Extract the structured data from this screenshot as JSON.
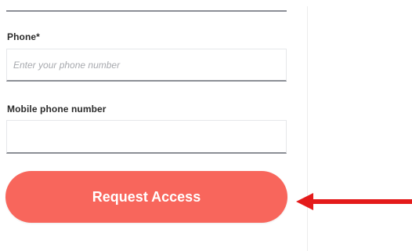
{
  "form": {
    "phone_label": "Phone*",
    "phone_placeholder": "Enter your phone number",
    "mobile_label": "Mobile phone number",
    "mobile_placeholder": ""
  },
  "actions": {
    "request_access_label": "Request Access"
  },
  "colors": {
    "button": "#f8665c",
    "arrow": "#e41b1b",
    "input_border": "#8c8f96"
  },
  "annotation": {
    "icon": "arrow-left-icon"
  }
}
